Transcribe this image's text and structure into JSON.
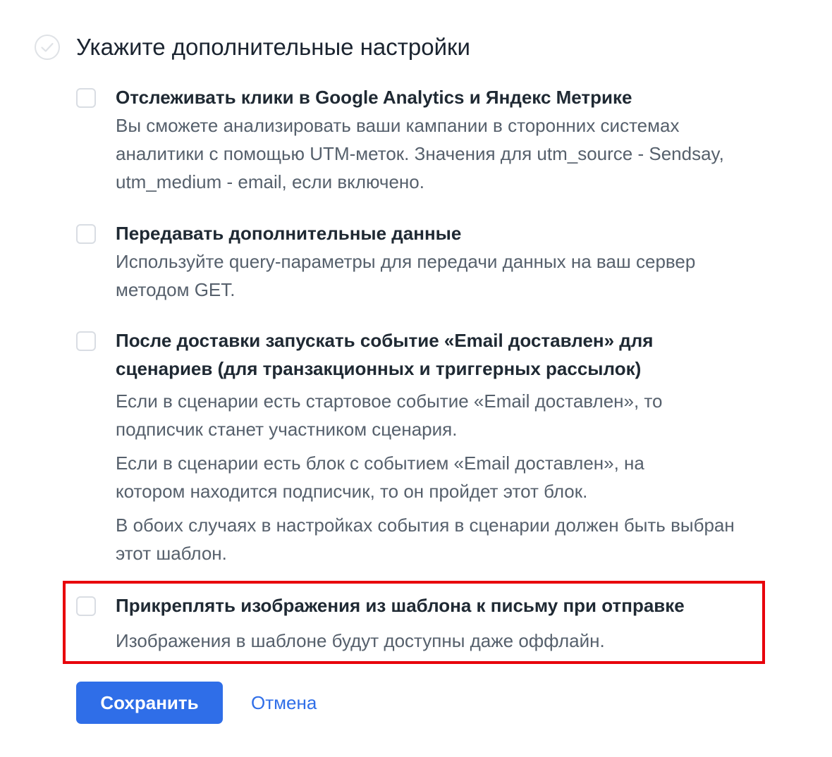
{
  "header": {
    "title": "Укажите дополнительные настройки",
    "icon": "check-circle-icon"
  },
  "options": [
    {
      "title": "Отслеживать клики в Google Analytics и Яндекс Метрике",
      "checked": false,
      "description": [
        "Вы сможете анализировать ваши кампании в сторонних системах аналитики с помощью UTM-меток. Значения для utm_source - Sendsay, utm_medium - email, если включено."
      ]
    },
    {
      "title": "Передавать дополнительные данные",
      "checked": false,
      "description": [
        "Используйте query-параметры для передачи данных на ваш сервер методом GET."
      ]
    },
    {
      "title": "После доставки запускать событие «Email доставлен» для сценариев (для транзакционных и триггерных рассылок)",
      "checked": false,
      "description": [
        "Если в сценарии есть стартовое событие «Email доставлен», то подписчик станет участником сценария.",
        "Если в сценарии есть блок с событием «Email доставлен», на котором находится подписчик, то он пройдет этот блок.",
        "В обоих случаях в настройках события в сценарии должен быть выбран этот шаблон."
      ]
    },
    {
      "title": "Прикреплять изображения из шаблона к письму при отправке",
      "checked": false,
      "highlighted": true,
      "description": [
        "Изображения в шаблоне будут доступны даже оффлайн."
      ]
    }
  ],
  "actions": {
    "save_label": "Сохранить",
    "cancel_label": "Отмена"
  },
  "colors": {
    "primary": "#2f6ee8",
    "highlight": "#e8000b",
    "title_text": "#1f2933",
    "secondary_text": "#56606c",
    "checkbox_border": "#d9dde3"
  }
}
